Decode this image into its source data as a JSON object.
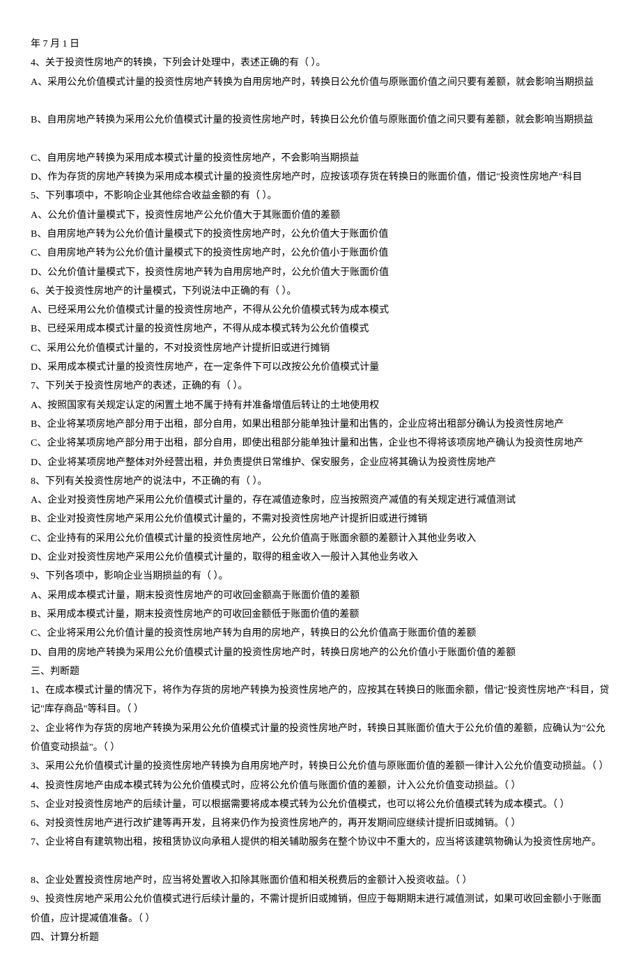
{
  "lines": [
    "年 7 月 1 日",
    "4、关于投资性房地产的转换，下列会计处理中，表述正确的有（  ）。",
    "A、采用公允价值模式计量的投资性房地产转换为自用房地产时，转换日公允价值与原账面价值之间只要有差额，就会影响当期损益",
    "",
    "B、自用房地产转换为采用公允价值模式计量的投资性房地产时，转换日公允价值与原账面价值之间只要有差额，就会影响当期损益",
    "",
    "C、自用房地产转换为采用成本模式计量的投资性房地产，不会影响当期损益",
    "D、作为存货的房地产转换为采用成本模式计量的投资性房地产时，应按该项存货在转换日的账面价值，借记\"投资性房地产\"科目",
    "5、下列事项中，不影响企业其他综合收益金额的有（  ）。",
    "A、公允价值计量模式下，投资性房地产公允价值大于其账面价值的差额",
    "B、自用房地产转为公允价值计量模式下的投资性房地产时，公允价值大于账面价值",
    "C、自用房地产转为公允价值计量模式下的投资性房地产时，公允价值小于账面价值",
    "D、公允价值计量模式下，投资性房地产转为自用房地产时，公允价值大于账面价值",
    "6、关于投资性房地产的计量模式，下列说法中正确的有（  ）。",
    "A、已经采用公允价值模式计量的投资性房地产，不得从公允价值模式转为成本模式",
    "B、已经采用成本模式计量的投资性房地产，不得从成本模式转为公允价值模式",
    "C、采用公允价值模式计量的，不对投资性房地产计提折旧或进行摊销",
    "D、采用成本模式计量的投资性房地产，在一定条件下可以改按公允价值模式计量",
    "7、下列关于投资性房地产的表述，正确的有（  ）。",
    "A、按照国家有关规定认定的闲置土地不属于持有并准备增值后转让的土地使用权",
    "B、企业将某项房地产部分用于出租，部分自用，如果出租部分能单独计量和出售的，企业应将出租部分确认为投资性房地产",
    "C、企业将某项房地产部分用于出租，部分自用，即使出租部分能单独计量和出售，企业也不得将该项房地产确认为投资性房地产",
    "D、企业将某项房地产整体对外经营出租，并负责提供日常维护、保安服务，企业应将其确认为投资性房地产",
    "8、下列有关投资性房地产的说法中，不正确的有（  ）。",
    "A、企业对投资性房地产采用公允价值模式计量的，存在减值迹象时，应当按照资产减值的有关规定进行减值测试",
    "B、企业对投资性房地产采用公允价值模式计量的，不需对投资性房地产计提折旧或进行摊销",
    "C、企业持有的采用公允价值模式计量的投资性房地产，公允价值高于账面余额的差额计入其他业务收入",
    "D、企业对投资性房地产采用公允价值模式计量的，取得的租金收入一般计入其他业务收入",
    "9、下列各项中，影响企业当期损益的有（  ）。",
    "A、采用成本模式计量，期末投资性房地产的可收回金额高于账面价值的差额",
    "B、采用成本模式计量，期末投资性房地产的可收回金额低于账面价值的差额",
    "C、企业将采用公允价值计量的投资性房地产转为自用的房地产，转换日的公允价值高于账面价值的差额",
    "D、自用的房地产转换为采用公允价值模式计量的投资性房地产时，转换日房地产的公允价值小于账面价值的差额",
    "三、判断题",
    "1、在成本模式计量的情况下，将作为存货的房地产转换为投资性房地产的，应按其在转换日的账面余额，借记\"投资性房地产\"科目，贷记\"库存商品\"等科目。（  ）",
    "2、企业将作为存货的房地产转换为采用公允价值模式计量的投资性房地产时，转换日其账面价值大于公允价值的差额，应确认为\"公允价值变动损益\"。（  ）",
    "3、采用公允价值模式计量的投资性房地产转换为自用房地产时，转换日公允价值与原账面价值的差额一律计入公允价值变动损益。（  ）",
    "4、投资性房地产由成本模式转为公允价值模式时，应将公允价值与账面价值的差额，计入公允价值变动损益。（  ）",
    "5、企业对投资性房地产的后续计量，可以根据需要将成本模式转为公允价值模式，也可以将公允价值模式转为成本模式。（  ）",
    "6、对投资性房地产进行改扩建等再开发，且将来仍作为投资性房地产的，再开发期间应继续计提折旧或摊销。（  ）",
    "7、企业将自有建筑物出租，按租赁协议向承租人提供的相关辅助服务在整个协议中不重大的，应当将该建筑物确认为投资性房地产。",
    "",
    "8、企业处置投资性房地产时，应当将处置收入扣除其账面价值和相关税费后的金额计入投资收益。（  ）",
    "9、投资性房地产采用公允价值模式进行后续计量的，不需计提折旧或摊销，但应于每期期末进行减值测试，如果可收回金额小于账面价值，应计提减值准备。（  ）",
    "四、计算分析题"
  ]
}
